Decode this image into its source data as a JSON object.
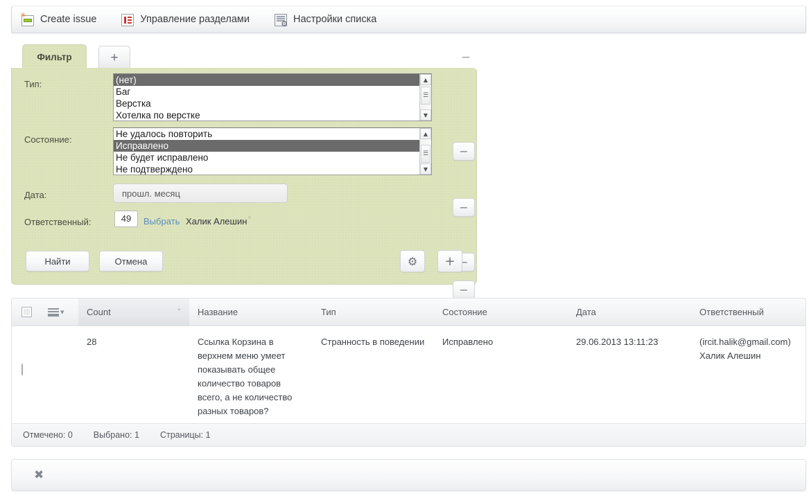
{
  "toolbar": {
    "items": [
      {
        "label": "Create issue",
        "icon": "create-issue-icon"
      },
      {
        "label": "Управление разделами",
        "icon": "manage-sections-icon"
      },
      {
        "label": "Настройки списка",
        "icon": "list-settings-icon"
      }
    ]
  },
  "filter": {
    "tab_label": "Фильтр",
    "add_tab_label": "+",
    "collapse_label": "−",
    "rows": {
      "type": {
        "label": "Тип:",
        "options": [
          "(нет)",
          "Баг",
          "Верстка",
          "Хотелка по верстке"
        ],
        "selected": "(нет)",
        "remove_label": "−"
      },
      "state": {
        "label": "Состояние:",
        "options": [
          "Не удалось повторить",
          "Исправлено",
          "Не будет исправлено",
          "Не подтверждено"
        ],
        "selected": "Исправлено",
        "remove_label": "−"
      },
      "date": {
        "label": "Дата:",
        "value": "прошл. месяц",
        "remove_label": "−"
      },
      "responsible": {
        "label": "Ответственный:",
        "id_value": "49",
        "pick_label": "Выбрать",
        "name": "Халик Алешин",
        "clear_label": "×",
        "remove_label": "−"
      }
    },
    "actions": {
      "search_label": "Найти",
      "cancel_label": "Отмена",
      "settings_label": "⚙",
      "add_label": "+"
    }
  },
  "table": {
    "headers": {
      "select_all": "select-all-checkbox",
      "menu": "row-menu-icon",
      "count": "Count",
      "name": "Название",
      "type": "Тип",
      "state": "Состояние",
      "date": "Дата",
      "responsible": "Ответственный"
    },
    "sort_caret": "˅",
    "rows": [
      {
        "count": "28",
        "name": "Ссылка Корзина в верхнем меню умеет показывать общее количество товаров всего, а не количество разных товаров?",
        "type": "Странность в поведении",
        "state": "Исправлено",
        "date": "29.06.2013 13:11:23",
        "responsible_email": "(ircit.halik@gmail.com)",
        "responsible_name": "Халик Алешин"
      }
    ],
    "footer": {
      "marked": "Отмечено: 0",
      "selected": "Выбрано: 1",
      "pages": "Страницы:  1"
    }
  },
  "bottom": {
    "close_label": "✖"
  },
  "colors": {
    "panel_green": "#dde4bd",
    "selection_gray": "#6b6b6b",
    "link_blue": "#5b8dbb",
    "accent_green": "#9bc93c"
  }
}
